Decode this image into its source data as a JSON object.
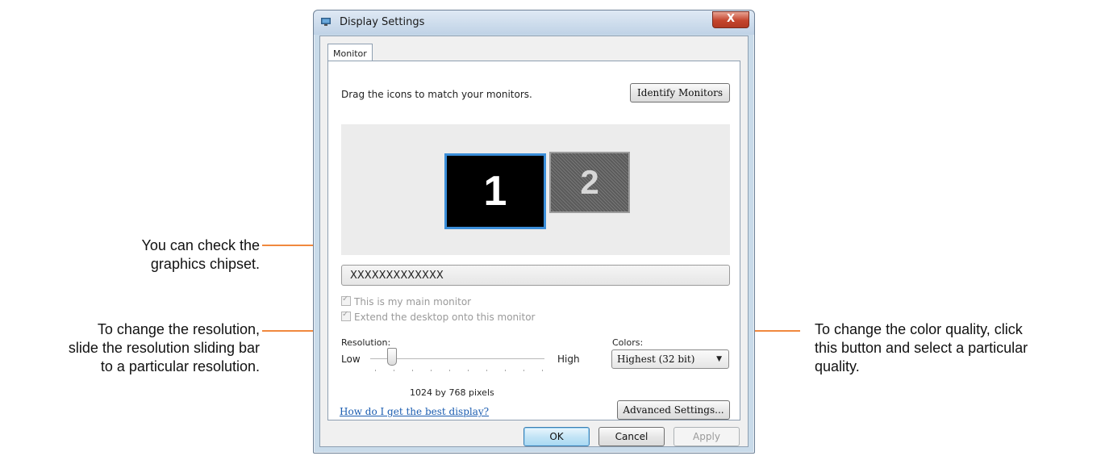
{
  "annotations": {
    "chipset": [
      "You can check the",
      "graphics chipset."
    ],
    "resolution": [
      "To change the resolution,",
      "slide the resolution sliding bar",
      "to a particular resolution."
    ],
    "colors": [
      "To change the color quality, click",
      "this button and select a particular",
      "quality."
    ]
  },
  "window": {
    "title": "Display Settings",
    "close_label": "X"
  },
  "tabs": [
    {
      "label": "Monitor",
      "selected": true
    }
  ],
  "panel": {
    "instruction": "Drag the icons to match your monitors.",
    "identify_button": "Identify Monitors",
    "monitors": [
      {
        "number": "1",
        "selected": true
      },
      {
        "number": "2",
        "selected": false
      }
    ],
    "chipset_value": "XXXXXXXXXXXXX",
    "main_monitor_label": "This is my main monitor",
    "main_monitor_checked": true,
    "extend_label": "Extend the desktop onto this monitor",
    "extend_checked": true,
    "resolution_label": "Resolution:",
    "low_label": "Low",
    "high_label": "High",
    "resolution_value": "1024 by 768 pixels",
    "resolution_slider_fraction": 0.12,
    "colors_label": "Colors:",
    "colors_selected": "Highest (32 bit)",
    "help_link": "How do I get the best display?",
    "advanced_button": "Advanced Settings..."
  },
  "footer": {
    "ok": "OK",
    "cancel": "Cancel",
    "apply": "Apply"
  },
  "colors": {
    "callout": "#f0883e",
    "selected_monitor_border": "#3b8ed9",
    "link": "#1a5cb0"
  }
}
